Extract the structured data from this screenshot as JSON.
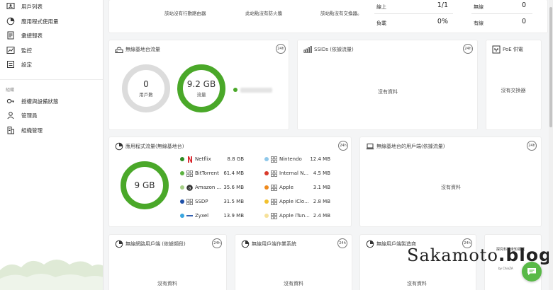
{
  "sidebar": {
    "items": [
      {
        "label": "用戶列表",
        "icon": "user-list-icon"
      },
      {
        "label": "應用程式使用量",
        "icon": "pie-chart-icon"
      },
      {
        "label": "彙總報表",
        "icon": "report-icon"
      },
      {
        "label": "監控",
        "icon": "monitor-chart-icon"
      },
      {
        "label": "設定",
        "icon": "settings-list-icon"
      }
    ],
    "section": "組織",
    "org_items": [
      {
        "label": "授權與設備狀態",
        "icon": "key-icon"
      },
      {
        "label": "管理員",
        "icon": "admin-icon"
      },
      {
        "label": "組織管理",
        "icon": "building-icon"
      }
    ]
  },
  "top": {
    "no_router": "該站沒有行動路由器",
    "no_firewall": "此站點沒有防火牆",
    "no_switch": "該站點沒有交換器。",
    "online_label": "線上",
    "online_value": "1/1",
    "load_label": "負載",
    "load_value": "0%",
    "wireless_label": "無線",
    "wireless_value": "0",
    "wired_label": "有線",
    "wired_value": "0"
  },
  "ap_traffic": {
    "title": "無線基地台流量",
    "badge": "24h",
    "users_value": "0",
    "users_label": "用戶數",
    "traffic_value": "9.2 GB",
    "traffic_label": "流量"
  },
  "ssids": {
    "title": "SSIDs (依據流量)",
    "badge": "24h",
    "empty": "沒有資料"
  },
  "poe": {
    "title": "PoE 供電",
    "empty": "沒有交換器"
  },
  "app_traffic": {
    "title": "應用程式流量(無線基地台)",
    "badge": "24h",
    "total": "9 GB",
    "left": [
      {
        "name": "Netflix",
        "value": "8.8 GB",
        "color": "#2e8b22",
        "icon": "netflix-icon"
      },
      {
        "name": "BitTorrent",
        "value": "61.4 MB",
        "color": "#5cb341",
        "icon": "apps-grid-icon"
      },
      {
        "name": "Amazon ...",
        "value": "35.6 MB",
        "color": "#a6cf86",
        "icon": "amazon-icon"
      },
      {
        "name": "SSDP",
        "value": "31.5 MB",
        "color": "#1e4fa8",
        "icon": "apps-grid-icon"
      },
      {
        "name": "Zyxel",
        "value": "13.9 MB",
        "color": "#39a6e0",
        "icon": "zyxel-icon"
      }
    ],
    "right": [
      {
        "name": "Nintendo",
        "value": "12.4 MB",
        "color": "#8fc8ea",
        "icon": "apps-grid-icon"
      },
      {
        "name": "Internal N...",
        "value": "4.5 MB",
        "color": "#d93a2b",
        "icon": "apps-grid-icon"
      },
      {
        "name": "Apple",
        "value": "3.1 MB",
        "color": "#ef8a1d",
        "icon": "apps-grid-icon"
      },
      {
        "name": "Apple iClo...",
        "value": "2.8 MB",
        "color": "#f2c12e",
        "icon": "apps-grid-icon"
      },
      {
        "name": "Apple iTun...",
        "value": "2.4 MB",
        "color": "#f6e19a",
        "icon": "apps-grid-icon"
      }
    ]
  },
  "ap_clients": {
    "title": "無線基地台的用戶端(依據流量)",
    "badge": "24h",
    "empty": "沒有資料"
  },
  "wl_clients": {
    "title": "無線網路用戶端 (依據頻段)",
    "badge": "24h",
    "empty": "沒有資料"
  },
  "wl_os": {
    "title": "無線用戶端作業系統",
    "badge": "24h",
    "empty": "沒有資料"
  },
  "wl_mfr": {
    "title": "無線用戶端製造商",
    "badge": "24h",
    "empty": "沒有資料"
  },
  "watermark": {
    "text_a": "Sakamoto",
    "text_b": ".blog",
    "sub": "探究科技未知領域",
    "by": "by ChinZA"
  },
  "colors": {
    "green": "#4aa829",
    "ring_grey": "#dcdcdc"
  }
}
